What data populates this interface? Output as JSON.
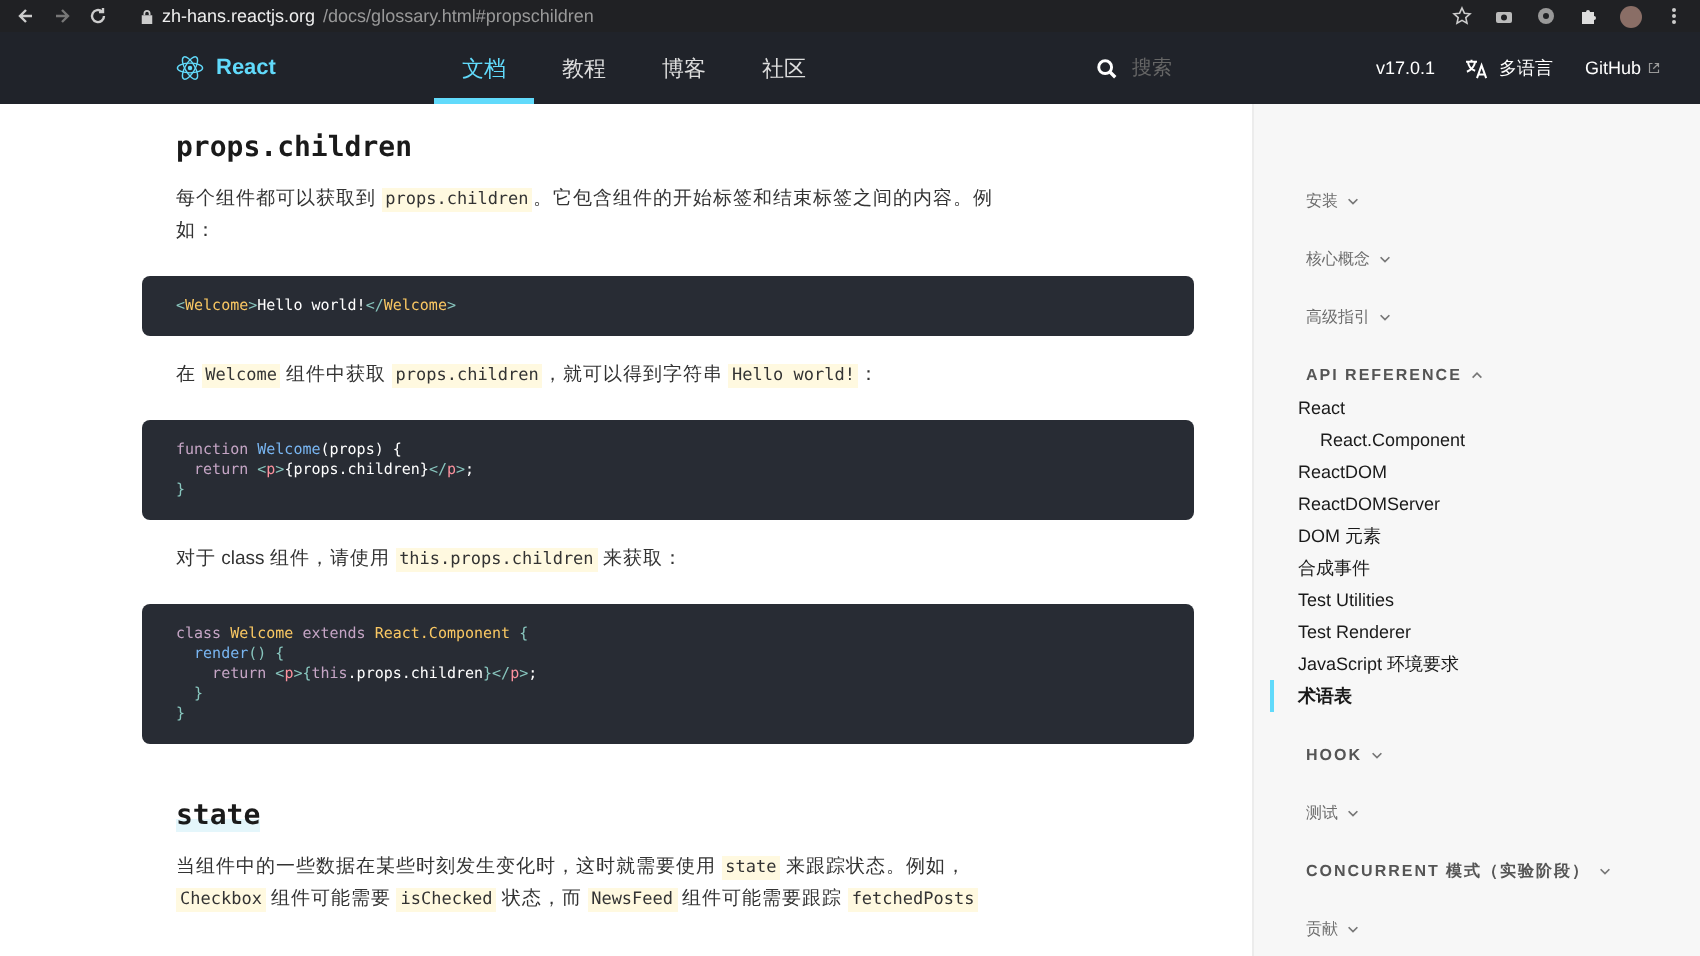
{
  "browser": {
    "url_domain": "zh-hans.reactjs.org",
    "url_path": "/docs/glossary.html#propschildren"
  },
  "nav": {
    "brand": "React",
    "tabs": [
      {
        "label": "文档",
        "selected": true
      },
      {
        "label": "教程",
        "selected": false
      },
      {
        "label": "博客",
        "selected": false
      },
      {
        "label": "社区",
        "selected": false
      }
    ],
    "search": {
      "placeholder": "搜索"
    },
    "version": "v17.0.1",
    "language": "多语言",
    "github": "GitHub"
  },
  "content": [
    {
      "kind": "heading",
      "text": "props.children",
      "highlight": false
    },
    {
      "kind": "paragraph",
      "segments": [
        {
          "kind": "text",
          "text": "每个组件都可以获取到 "
        },
        {
          "kind": "code",
          "text": "props.children"
        },
        {
          "kind": "text",
          "text": "。它包含组件的开始标签和结束标签之间的内容。例如："
        }
      ]
    },
    {
      "kind": "code",
      "lines": [
        [
          {
            "kind": "punct",
            "text": "<"
          },
          {
            "kind": "tag",
            "text": "Welcome"
          },
          {
            "kind": "punct",
            "text": ">"
          },
          {
            "kind": "plain",
            "text": "Hello world!"
          },
          {
            "kind": "punct",
            "text": "</"
          },
          {
            "kind": "tag",
            "text": "Welcome"
          },
          {
            "kind": "punct",
            "text": ">"
          }
        ]
      ]
    },
    {
      "kind": "paragraph",
      "segments": [
        {
          "kind": "text",
          "text": "在 "
        },
        {
          "kind": "code",
          "text": "Welcome"
        },
        {
          "kind": "text",
          "text": " 组件中获取 "
        },
        {
          "kind": "code",
          "text": "props.children"
        },
        {
          "kind": "text",
          "text": "，就可以得到字符串 "
        },
        {
          "kind": "code",
          "text": "Hello world!"
        },
        {
          "kind": "text",
          "text": "："
        }
      ]
    },
    {
      "kind": "code",
      "lines": [
        [
          {
            "kind": "keyword",
            "text": "function "
          },
          {
            "kind": "func",
            "text": "Welcome"
          },
          {
            "kind": "plain",
            "text": "(props) {"
          }
        ],
        [
          {
            "kind": "keyword",
            "text": "  return "
          },
          {
            "kind": "punct",
            "text": "<"
          },
          {
            "kind": "tagname",
            "text": "p"
          },
          {
            "kind": "punct",
            "text": ">"
          },
          {
            "kind": "plain",
            "text": "{props.children}"
          },
          {
            "kind": "punct",
            "text": "</"
          },
          {
            "kind": "tagname",
            "text": "p"
          },
          {
            "kind": "punct",
            "text": ">"
          },
          {
            "kind": "plain",
            "text": ";"
          }
        ],
        [
          {
            "kind": "punct",
            "text": "}"
          }
        ]
      ]
    },
    {
      "kind": "paragraph",
      "segments": [
        {
          "kind": "text",
          "text": "对于 class 组件，请使用 "
        },
        {
          "kind": "code",
          "text": "this.props.children"
        },
        {
          "kind": "text",
          "text": " 来获取："
        }
      ]
    },
    {
      "kind": "code",
      "lines": [
        [
          {
            "kind": "keyword",
            "text": "class "
          },
          {
            "kind": "tag",
            "text": "Welcome"
          },
          {
            "kind": "keyword",
            "text": " extends "
          },
          {
            "kind": "tag",
            "text": "React.Component"
          },
          {
            "kind": "punct",
            "text": " {"
          }
        ],
        [
          {
            "kind": "func",
            "text": "  render"
          },
          {
            "kind": "punct",
            "text": "() {"
          }
        ],
        [
          {
            "kind": "keyword",
            "text": "    return "
          },
          {
            "kind": "punct",
            "text": "<"
          },
          {
            "kind": "tagname",
            "text": "p"
          },
          {
            "kind": "punct",
            "text": ">"
          },
          {
            "kind": "punct",
            "text": "{"
          },
          {
            "kind": "keyword",
            "text": "this"
          },
          {
            "kind": "plain",
            "text": ".props.children"
          },
          {
            "kind": "punct",
            "text": "}</"
          },
          {
            "kind": "tagname",
            "text": "p"
          },
          {
            "kind": "punct",
            "text": ">"
          },
          {
            "kind": "plain",
            "text": ";"
          }
        ],
        [
          {
            "kind": "punct",
            "text": "  }"
          }
        ],
        [
          {
            "kind": "punct",
            "text": "}"
          }
        ]
      ]
    },
    {
      "kind": "heading",
      "text": "state",
      "highlight": true
    },
    {
      "kind": "paragraph",
      "segments": [
        {
          "kind": "text",
          "text": "当组件中的一些数据在某些时刻发生变化时，这时就需要使用 "
        },
        {
          "kind": "code",
          "text": "state"
        },
        {
          "kind": "text",
          "text": " 来跟踪状态。例如，"
        },
        {
          "kind": "code",
          "text": "Checkbox"
        },
        {
          "kind": "text",
          "text": " 组件可能需要 "
        },
        {
          "kind": "code",
          "text": "isChecked"
        },
        {
          "kind": "text",
          "text": " 状态，而 "
        },
        {
          "kind": "code",
          "text": "NewsFeed"
        },
        {
          "kind": "text",
          "text": " 组件可能需要跟踪 "
        },
        {
          "kind": "code",
          "text": "fetchedPosts"
        }
      ]
    }
  ],
  "sidebar": [
    {
      "label": "安装",
      "caps": false,
      "expanded": false
    },
    {
      "label": "核心概念",
      "caps": false,
      "expanded": false
    },
    {
      "label": "高级指引",
      "caps": false,
      "expanded": false
    },
    {
      "label": "API REFERENCE",
      "caps": true,
      "expanded": true,
      "items": [
        {
          "label": "React",
          "selected": false,
          "children": [
            {
              "label": "React.Component",
              "selected": false
            }
          ]
        },
        {
          "label": "ReactDOM",
          "selected": false
        },
        {
          "label": "ReactDOMServer",
          "selected": false
        },
        {
          "label": "DOM 元素",
          "selected": false
        },
        {
          "label": "合成事件",
          "selected": false
        },
        {
          "label": "Test Utilities",
          "selected": false
        },
        {
          "label": "Test Renderer",
          "selected": false
        },
        {
          "label": "JavaScript 环境要求",
          "selected": false
        },
        {
          "label": "术语表",
          "selected": true
        }
      ]
    },
    {
      "label": "HOOK",
      "caps": true,
      "expanded": false
    },
    {
      "label": "测试",
      "caps": false,
      "expanded": false
    },
    {
      "label": "CONCURRENT 模式（实验阶段）",
      "caps": true,
      "expanded": false
    },
    {
      "label": "贡献",
      "caps": false,
      "expanded": false
    }
  ]
}
